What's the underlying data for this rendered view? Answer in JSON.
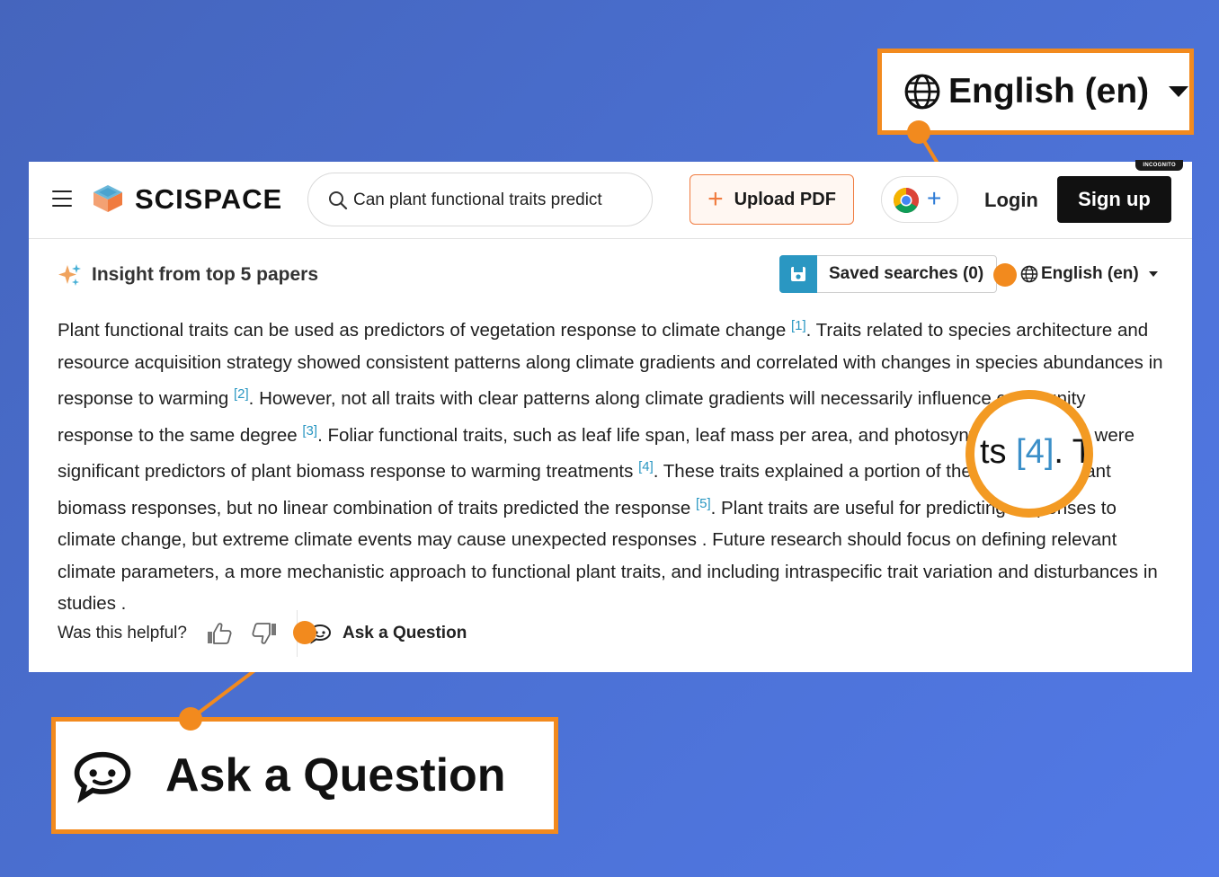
{
  "header": {
    "brand": "SCISPACE",
    "search_value": "Can plant functional traits predict",
    "upload_label": "Upload PDF",
    "login_label": "Login",
    "signup_label": "Sign up",
    "incognito_label": "INCOGNITO"
  },
  "insight": {
    "title": "Insight from top 5 papers",
    "saved_label": "Saved searches (0)",
    "language": "English (en)",
    "paragraph": [
      {
        "text": "Plant functional traits can be used as predictors of vegetation response to climate change "
      },
      {
        "cite": "[1]"
      },
      {
        "text": ". Traits related to species architecture and resource acquisition strategy showed consistent patterns along climate gradients and correlated with changes in species abundances in response to warming "
      },
      {
        "cite": "[2]"
      },
      {
        "text": ". However, not all traits with clear patterns along climate gradients will necessarily influence community response to the same degree "
      },
      {
        "cite": "[3]"
      },
      {
        "text": ". Foliar functional traits, such as leaf life span, leaf mass per area, and photosynthetic capacity, were significant predictors of plant biomass response to warming treatments "
      },
      {
        "cite": "[4]"
      },
      {
        "text": ". These traits explained a portion of the variation in plant biomass responses, but no linear combination of traits predicted the response "
      },
      {
        "cite": "[5]"
      },
      {
        "text": ". Plant traits are useful for predicting responses to climate change, but extreme climate events may cause unexpected responses . Future research should focus on defining relevant climate parameters, a more mechanistic approach to functional plant traits, and including intraspecific trait variation and disturbances in studies ."
      }
    ],
    "helpful_label": "Was this helpful?",
    "ask_label": "Ask a Question"
  },
  "magnifier": {
    "pre": "ts ",
    "cite": "[4]",
    "post": ". T"
  },
  "callouts": {
    "language": "English (en)",
    "ask": "Ask a Question"
  },
  "colors": {
    "accent": "#f28a1e",
    "cite": "#2a97c2",
    "background": "#4a6fd0"
  }
}
